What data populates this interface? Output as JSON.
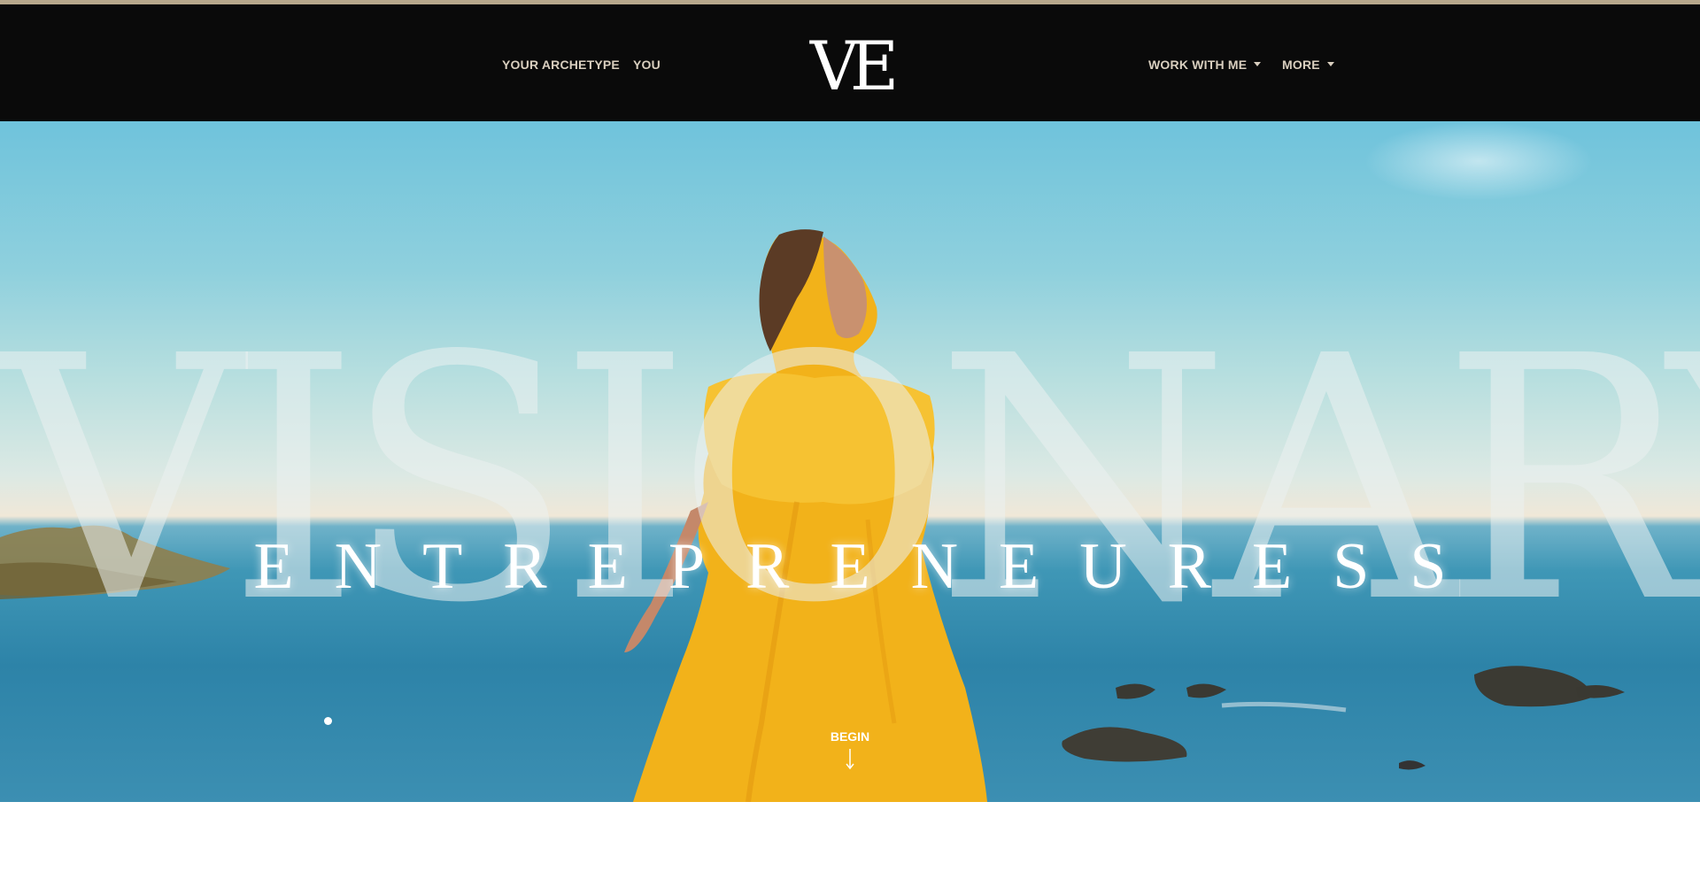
{
  "nav": {
    "left": [
      {
        "label": "YOUR ARCHETYPE"
      },
      {
        "label": "YOU"
      }
    ],
    "right": [
      {
        "label": "WORK WITH ME"
      },
      {
        "label": "MORE"
      }
    ],
    "logo_text": "VE"
  },
  "hero": {
    "big_word": "VISIONARY",
    "sub_word": "ENTREPRENEURESS",
    "cta_label": "BEGIN"
  },
  "colors": {
    "accent": "#b7a88c",
    "header_bg": "#0a0a0a",
    "nav_text": "#d9cfbf"
  },
  "icons": [
    "caret-down-icon",
    "arrow-down-icon"
  ]
}
